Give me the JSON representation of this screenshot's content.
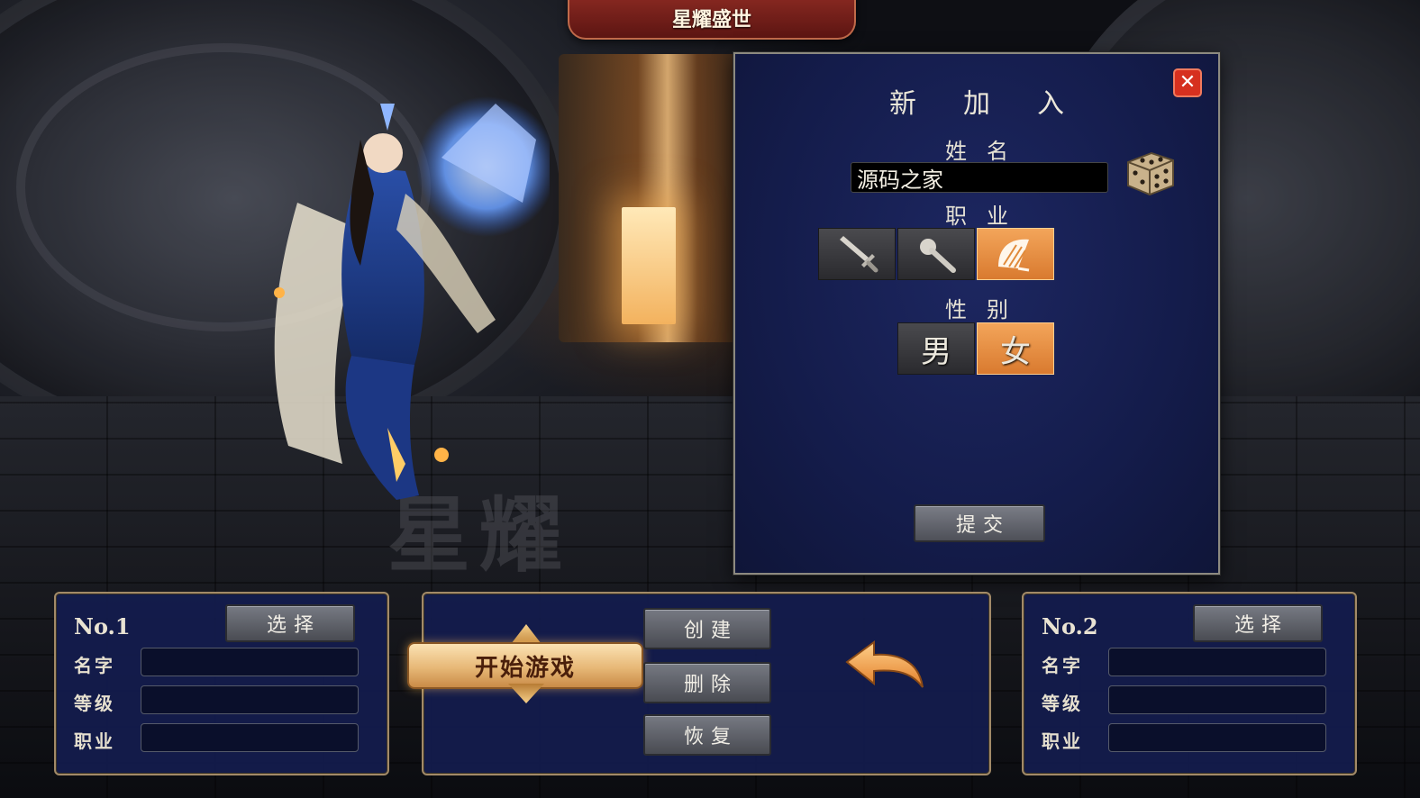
{
  "banner": {
    "title": "星耀盛世"
  },
  "scene": {
    "watermark": "星耀"
  },
  "dialog": {
    "title": "新加入",
    "close_glyph": "✕",
    "name_label": "姓名",
    "name_value": "源码之家",
    "class_label": "职业",
    "classes": [
      {
        "id": "warrior",
        "icon": "sword-icon",
        "selected": false
      },
      {
        "id": "mage",
        "icon": "staff-icon",
        "selected": false
      },
      {
        "id": "taoist",
        "icon": "fan-icon",
        "selected": true
      }
    ],
    "gender_label": "性别",
    "genders": [
      {
        "label": "男",
        "selected": false
      },
      {
        "label": "女",
        "selected": true
      }
    ],
    "submit_label": "提交"
  },
  "slot1": {
    "number": "No.1",
    "select_label": "选择",
    "name_label": "名字",
    "level_label": "等级",
    "class_label": "职业",
    "name_value": "",
    "level_value": "",
    "class_value": ""
  },
  "slot2": {
    "number": "No.2",
    "select_label": "选择",
    "name_label": "名字",
    "level_label": "等级",
    "class_label": "职业",
    "name_value": "",
    "level_value": "",
    "class_value": ""
  },
  "center": {
    "start_label": "开始游戏",
    "create_label": "创建",
    "delete_label": "删除",
    "restore_label": "恢复",
    "back_icon": "back-arrow-icon"
  },
  "colors": {
    "accent_orange": "#e8913f",
    "dialog_blue": "#1a2358",
    "close_red": "#d6301f",
    "banner_red": "#7a211b"
  }
}
